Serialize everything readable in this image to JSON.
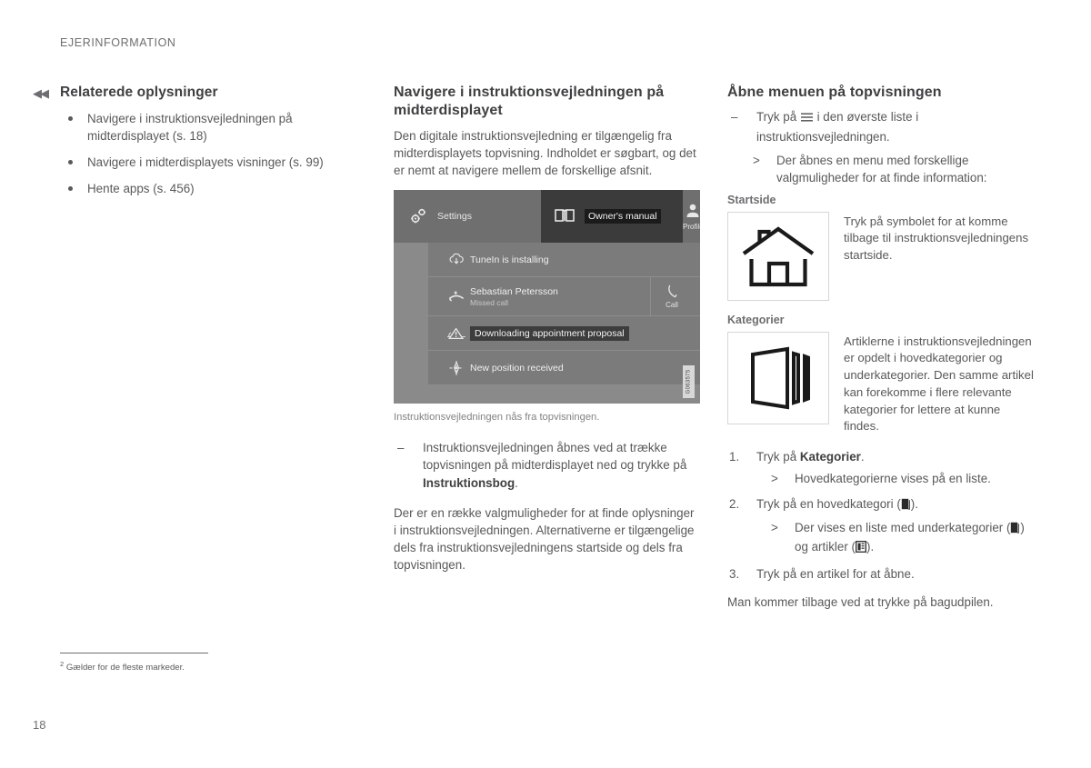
{
  "page": {
    "running_head": "EJERINFORMATION",
    "folio": "18",
    "back_marker": "◀◀"
  },
  "left_column": {
    "title": "Relaterede oplysninger",
    "links": [
      "Navigere i instruktionsvejledningen på midterdisplayet (s. 18)",
      "Navigere i midterdisplayets visninger (s. 99)",
      "Hente apps (s. 456)"
    ]
  },
  "middle_column": {
    "title": "Navigere i instruktionsvejledningen på midterdisplayet",
    "intro": "Den digitale instruktionsvejledning er tilgængelig fra midterdisplayets topvisning. Indholdet er søgbart, og det er nemt at navigere mellem de forskellige afsnit.",
    "figure": {
      "caption": "Instruktionsvejledningen nås fra topvisningen.",
      "image_code": "G063575",
      "tabs": [
        {
          "label": "Settings",
          "icon": "gear-icon",
          "active": false
        },
        {
          "label": "Owner's manual",
          "icon": "book-icon",
          "active": true
        },
        {
          "label": "Profile",
          "icon": "person-icon",
          "active": false
        }
      ],
      "notifications": [
        {
          "icon": "cloud-download-icon",
          "title": "TuneIn is installing",
          "subtitle": "",
          "action": "",
          "highlighted": false
        },
        {
          "icon": "missed-call-icon",
          "title": "Sebastian Petersson",
          "subtitle": "Missed call",
          "action": "Call",
          "highlighted": false
        },
        {
          "icon": "warning-car-icon",
          "title": "Downloading appointment proposal",
          "subtitle": "",
          "action": "",
          "highlighted": true
        },
        {
          "icon": "compass-icon",
          "title": "New position received",
          "subtitle": "",
          "action": "",
          "highlighted": false
        }
      ]
    },
    "instruction_dash": {
      "before": "Instruktionsvejledningen åbnes ved at trække topvisningen på midterdisplayet ned og trykke på ",
      "bold": "Instruktionsbog",
      "after": "."
    },
    "outro": "Der er en række valgmuligheder for at finde oplysninger i instruktionsvejledningen. Alternativerne er tilgængelige dels fra instruktionsvejledningens startside og dels fra topvisningen."
  },
  "right_column": {
    "title": "Åbne menuen på topvisningen",
    "dash_step": {
      "before": "Tryk på ",
      "icon": "hamburger-menu-icon",
      "after": " i den øverste liste i instruktionsvejledningen."
    },
    "dash_result": "Der åbnes en menu med forskellige valgmuligheder for at finde information:",
    "symbols": [
      {
        "heading": "Startside",
        "icon": "home-icon",
        "text": "Tryk på symbolet for at komme tilbage til instruktionsvejledningens startside."
      },
      {
        "heading": "Kategorier",
        "icon": "categories-stack-icon",
        "text": "Artiklerne i instruktionsvejledningen er opdelt i hovedkategorier og underkategorier. Den samme artikel kan forekomme i flere relevante kategorier for lettere at kunne findes."
      }
    ],
    "steps": [
      {
        "before": "Tryk på ",
        "bold": "Kategorier",
        "after": ".",
        "result": "Hovedkategorierne vises på en liste."
      },
      {
        "before": "Tryk på en hovedkategori (",
        "icon": "category-page-icon",
        "after": ").",
        "result_before": "Der vises en liste med underkategorier (",
        "result_icon_1": "category-page-icon",
        "result_mid": ") og artikler (",
        "result_icon_2": "article-page-icon",
        "result_after": ")."
      },
      {
        "before": "Tryk på en artikel for at åbne.",
        "bold": "",
        "after": ""
      }
    ],
    "closing": "Man kommer tilbage ved at trykke på bagudpilen."
  },
  "footnote": {
    "marker": "2",
    "text": "Gælder for de fleste markeder."
  }
}
